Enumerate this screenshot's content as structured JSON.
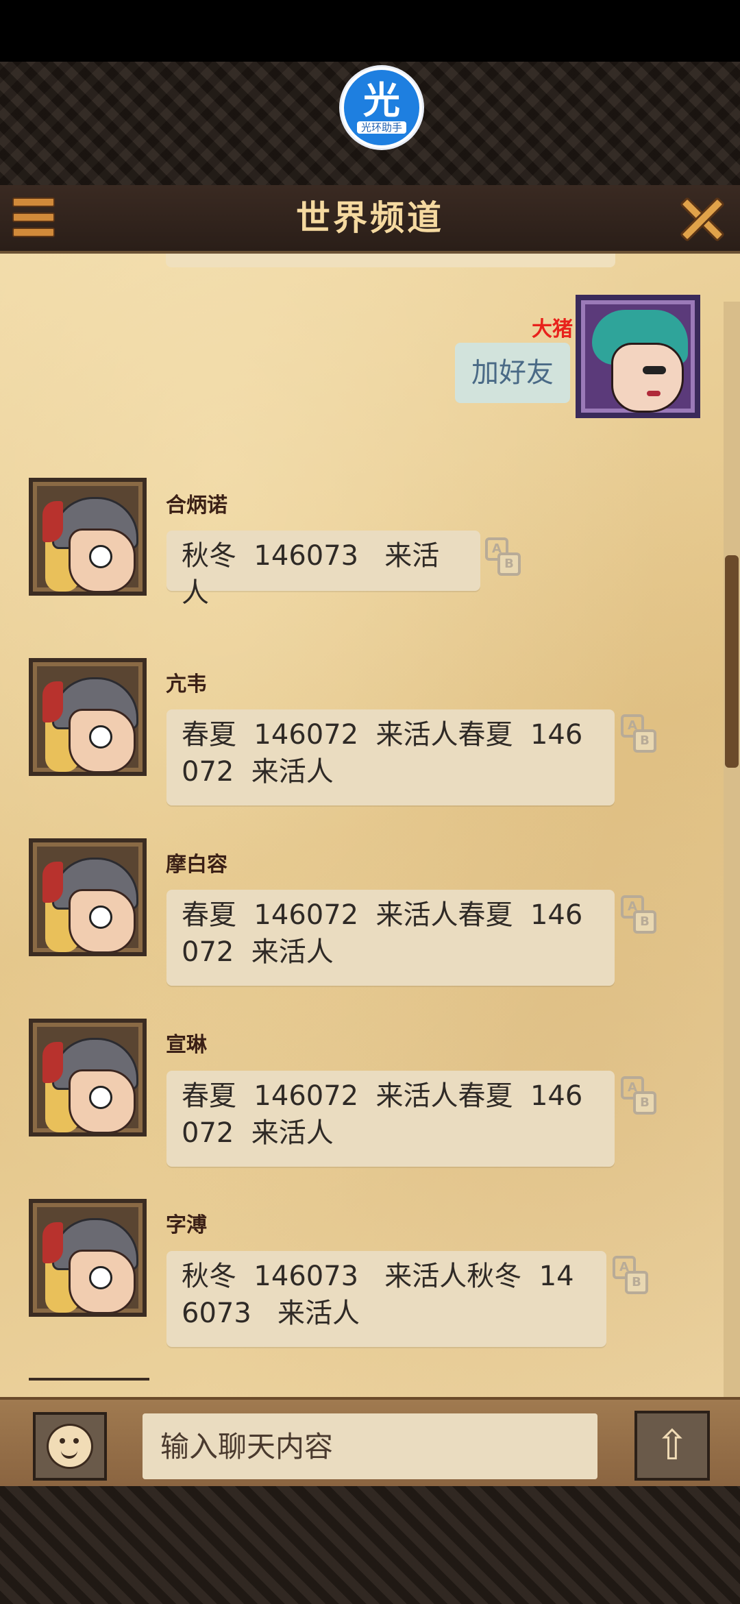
{
  "header": {
    "title": "世界频道"
  },
  "logo": {
    "char": "光",
    "caption": "光环助手"
  },
  "my_message": {
    "name": "大猪",
    "text": "加好友"
  },
  "messages": [
    {
      "name": "合炳诺",
      "text": "秋冬  146073   来活人"
    },
    {
      "name": "亢韦",
      "text": "春夏  146072  来活人春夏  146072  来活人"
    },
    {
      "name": "摩白容",
      "text": "春夏  146072  来活人春夏  146072  来活人"
    },
    {
      "name": "宣琳",
      "text": "春夏  146072  来活人春夏  146072  来活人"
    },
    {
      "name": "字溥",
      "text": "秋冬  146073   来活人秋冬  146073   来活人"
    }
  ],
  "translate_icon": {
    "a": "A",
    "b": "B"
  },
  "input": {
    "placeholder": "输入聊天内容"
  },
  "send_icon": "arrow-up-icon",
  "colors": {
    "title": "#f5d9a0",
    "my_name": "#e8221c",
    "parchment": "#e3c487"
  }
}
